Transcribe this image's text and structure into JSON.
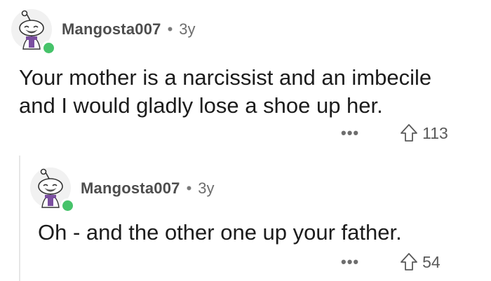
{
  "parent_comment": {
    "username": "Mangosta007",
    "separator": "•",
    "age": "3y",
    "body_lines": [
      "Your mother is a narcissist and an imbecile",
      "and I would gladly lose a shoe up her."
    ],
    "more_label": "•••",
    "upvotes": "113"
  },
  "reply_comment": {
    "username": "Mangosta007",
    "separator": "•",
    "age": "3y",
    "body_lines": [
      "Oh - and the other one up your father."
    ],
    "more_label": "•••",
    "upvotes": "54"
  },
  "colors": {
    "online_indicator": "#46c36a",
    "thread_line": "#e6e6e6",
    "text_primary": "#1c1c1c",
    "text_meta": "#6e6e6e"
  },
  "icons": {
    "avatar": "snoo-avatar-icon",
    "upvote": "upvote-arrow-icon",
    "more": "more-options-icon"
  }
}
